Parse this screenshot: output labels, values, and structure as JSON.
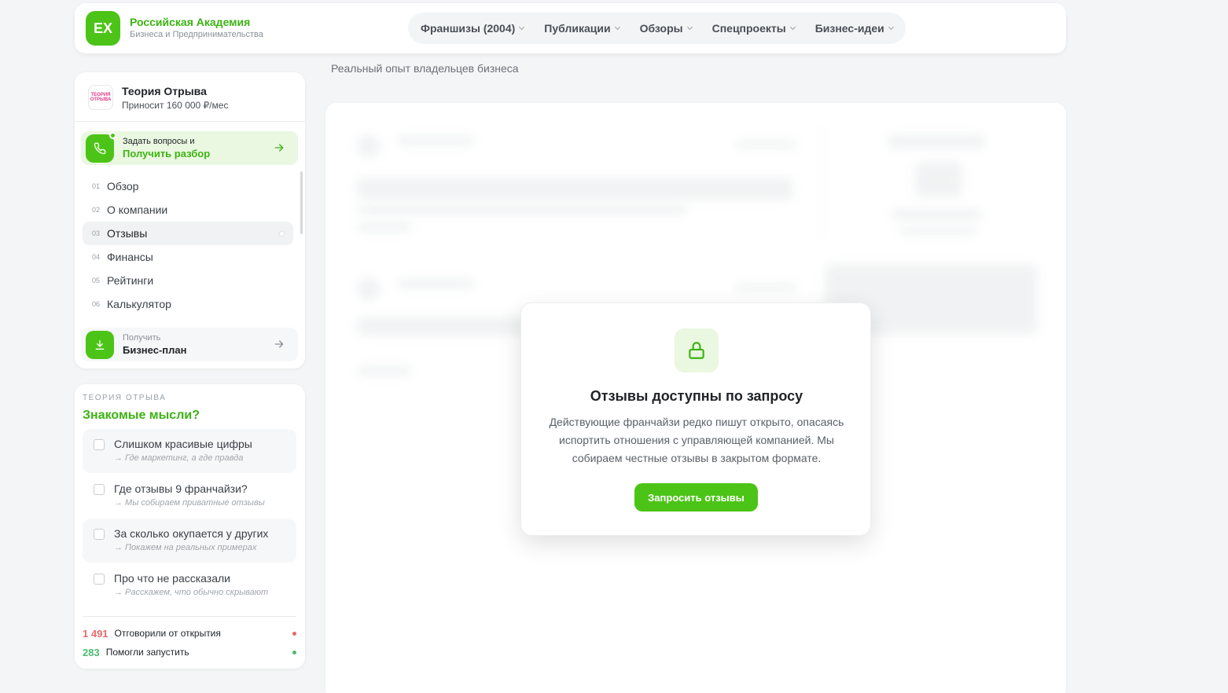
{
  "header": {
    "logo_mark": "EX",
    "logo_title": "Российская Академия",
    "logo_subtitle": "Бизнеса и Предпринимательства",
    "nav": [
      "Франшизы (2004)",
      "Публикации",
      "Обзоры",
      "Спецпроекты",
      "Бизнес-идеи"
    ]
  },
  "tagline": "Реальный опыт владельцев бизнеса",
  "sidebar": {
    "brand_logo_text": "ТЕОРИЯ ОТРЫВА",
    "brand_name": "Теория Отрыва",
    "brand_income": "Приносит 160 000 ₽/мес",
    "cta_small": "Задать вопросы и",
    "cta_big": "Получить разбор",
    "menu": [
      {
        "num": "01",
        "label": "Обзор"
      },
      {
        "num": "02",
        "label": "О компании"
      },
      {
        "num": "03",
        "label": "Отзывы"
      },
      {
        "num": "04",
        "label": "Финансы"
      },
      {
        "num": "05",
        "label": "Рейтинги"
      },
      {
        "num": "06",
        "label": "Калькулятор"
      }
    ],
    "active_index": 2,
    "plan_small": "Получить",
    "plan_big": "Бизнес-план"
  },
  "thoughts": {
    "eyebrow": "ТЕОРИЯ ОТРЫВА",
    "title": "Знакомые мысли?",
    "items": [
      {
        "text": "Слишком красивые цифры",
        "hint": "→ Где маркетинг, а где правда"
      },
      {
        "text": "Где отзывы 9 франчайзи?",
        "hint": "→ Мы собираем приватные отзывы"
      },
      {
        "text": "За сколько окупается у других",
        "hint": "→ Покажем на реальных примерах"
      },
      {
        "text": "Про что не рассказали",
        "hint": "→ Расскажем, что обычно скрывают"
      }
    ],
    "stats": [
      {
        "value": "1 491",
        "label": "Отговорили от открытия",
        "color": "#e86a6a"
      },
      {
        "value": "283",
        "label": "Помогли запустить",
        "color": "#4cbb6e"
      }
    ]
  },
  "modal": {
    "icon": "lock-icon",
    "title": "Отзывы доступны по запросу",
    "text": "Действующие франчайзи редко пишут открыто, опасаясь испортить отношения с управляющей компанией. Мы собираем честные отзывы в закрытом формате.",
    "button": "Запросить отзывы"
  },
  "colors": {
    "accent": "#4cc417",
    "accent_text": "#3db313",
    "background": "#f4f5f6"
  }
}
